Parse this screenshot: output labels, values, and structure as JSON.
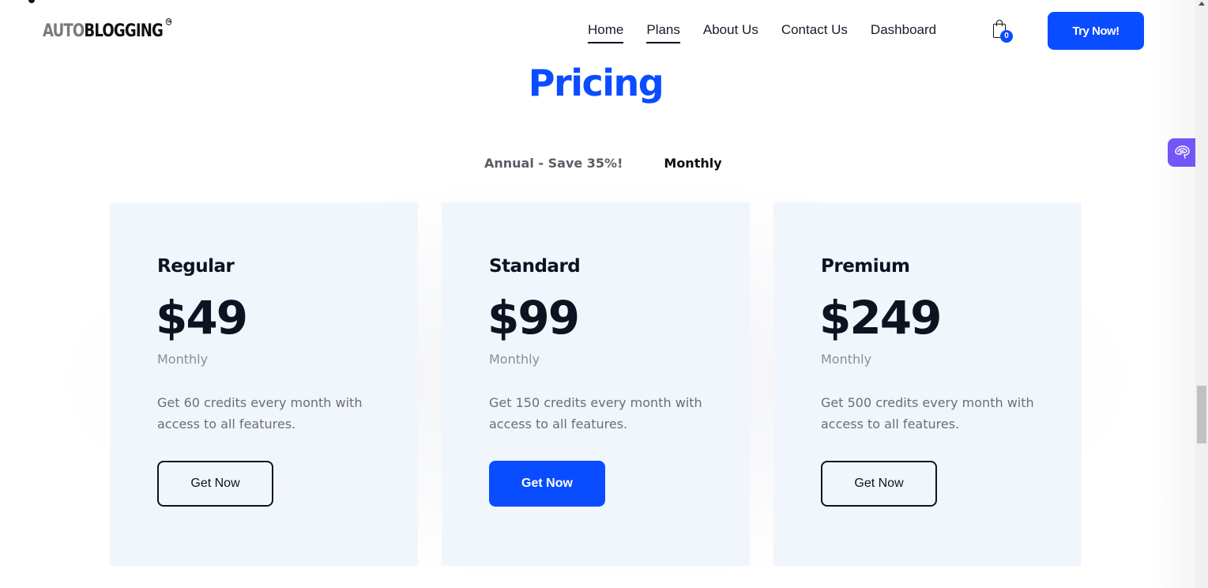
{
  "header": {
    "logo": {
      "part1": "AUTO",
      "part2": "BLOGGING",
      "trademark": "TM"
    },
    "nav": [
      {
        "label": "Home",
        "active": true
      },
      {
        "label": "Plans",
        "active": true
      },
      {
        "label": "About Us",
        "active": false
      },
      {
        "label": "Contact Us",
        "active": false
      },
      {
        "label": "Dashboard",
        "active": false
      }
    ],
    "cart": {
      "icon": "shopping-bag-icon",
      "count": "0"
    },
    "cta_label": "Try Now!"
  },
  "main": {
    "title": "Pricing",
    "billing_toggle": {
      "annual_label": "Annual - Save 35%!",
      "monthly_label": "Monthly",
      "selected": "Monthly"
    },
    "plans": [
      {
        "name": "Regular",
        "price": "$49",
        "period": "Monthly",
        "description": "Get 60 credits every month with access to all features.",
        "button_label": "Get Now",
        "highlighted": false
      },
      {
        "name": "Standard",
        "price": "$99",
        "period": "Monthly",
        "description": "Get 150 credits every month with access to all features.",
        "button_label": "Get Now",
        "highlighted": true
      },
      {
        "name": "Premium",
        "price": "$249",
        "period": "Monthly",
        "description": "Get 500 credits every month with access to all features.",
        "button_label": "Get Now",
        "highlighted": false
      }
    ]
  },
  "widgets": {
    "ai_assistant_icon": "brain-icon"
  },
  "colors": {
    "accent": "#0a4cff",
    "card_bg": "#f1f6fd",
    "widget": "#7356f7",
    "text_dark": "#0d1321"
  }
}
